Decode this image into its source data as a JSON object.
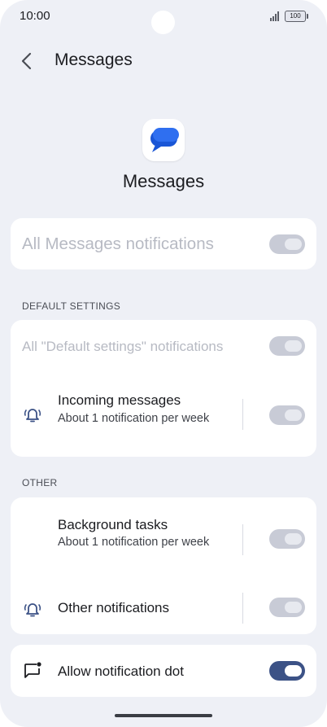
{
  "status_bar": {
    "time": "10:00",
    "battery": "100"
  },
  "header": {
    "title": "Messages"
  },
  "app": {
    "name": "Messages"
  },
  "master": {
    "label": "All Messages notifications",
    "enabled": false
  },
  "default_settings": {
    "section_label": "DEFAULT SETTINGS",
    "all_label": "All \"Default settings\" notifications",
    "incoming": {
      "title": "Incoming messages",
      "subtitle": "About 1 notification per week",
      "icon": "bell-ringing-icon"
    }
  },
  "other": {
    "section_label": "OTHER",
    "background": {
      "title": "Background tasks",
      "subtitle": "About 1 notification per week"
    },
    "other_notifications": {
      "title": "Other notifications",
      "icon": "bell-ringing-icon"
    }
  },
  "dot": {
    "title": "Allow notification dot",
    "icon": "message-dot-icon",
    "enabled": true
  },
  "colors": {
    "accent": "#3c5286",
    "background": "#eef0f6",
    "card": "#ffffff"
  }
}
